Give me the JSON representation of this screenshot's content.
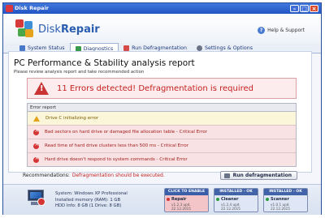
{
  "window": {
    "title": "Disk Repair"
  },
  "header": {
    "brand_prefix": "Disk",
    "brand_suffix": "Repair",
    "help_label": "Help & Support"
  },
  "tabs": [
    {
      "label": "System Status",
      "icon": "monitor-icon",
      "active": false
    },
    {
      "label": "Diagnostics",
      "icon": "diagnostics-icon",
      "active": true
    },
    {
      "label": "Run Defragmentation",
      "icon": "defrag-icon",
      "active": false
    },
    {
      "label": "Settings & Options",
      "icon": "gear-icon",
      "active": false
    }
  ],
  "report": {
    "title": "PC Performance & Stability analysis report",
    "subtitle": "Please review analysis report and take recommended action",
    "alert": "11 Errors detected! Defragmentation is required",
    "list_header": "Error report",
    "rows": [
      {
        "type": "warning",
        "text": "Drive C initializing error"
      },
      {
        "type": "error",
        "text": "Bad sectors on hard drive or damaged file allocation table - Critical Error"
      },
      {
        "type": "error",
        "text": "Read time of hard drive clusters less than 500 ms - Critical Error"
      },
      {
        "type": "error",
        "text": "Hard drive doesn't respond to system commands - Critical Error"
      }
    ]
  },
  "recommendation": {
    "label": "Recommendations:",
    "value": "Defragmentation should be executed.",
    "button": "Run defragmentation"
  },
  "system": {
    "line1": "System: Windows XP Professional",
    "line2": "Installed memory (RAM): 1 GB",
    "line3": "HDD Info: 8 GB (1 Drive: 8 GB)"
  },
  "panels": [
    {
      "header": "CLICK TO ENABLE",
      "name": "Repair",
      "version": "v1.2.3 upd. 22.12.2015",
      "state": "red"
    },
    {
      "header": "INSTALLED - OK",
      "name": "Cleaner",
      "version": "v1.2.4 upd. 22.12.2015",
      "state": "ok"
    },
    {
      "header": "INSTALLED - OK",
      "name": "Scanner",
      "version": "v1.0.1 upd. 22.12.2015",
      "state": "ok"
    }
  ]
}
